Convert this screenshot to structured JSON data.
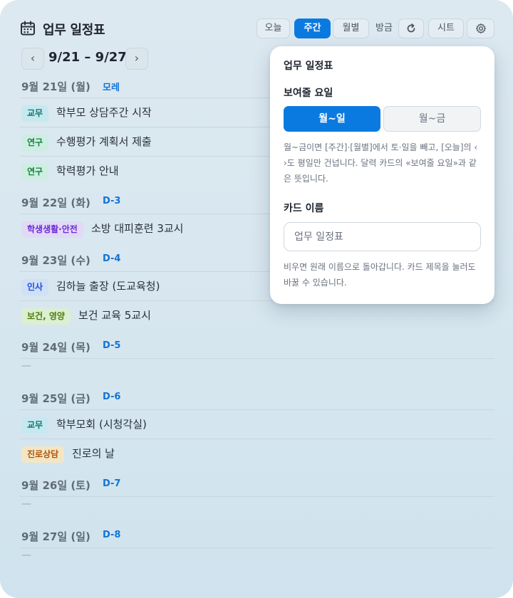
{
  "header": {
    "title": "업무 일정표",
    "calendar_icon": "calendar-icon",
    "today_label": "오늘",
    "week_label": "주간",
    "month_label": "월별",
    "just_now_label": "방금",
    "refresh_icon": "refresh-icon",
    "sheet_label": "시트",
    "settings_icon": "gear-icon",
    "active_view": "주간"
  },
  "week_nav": {
    "prev_icon": "‹",
    "next_icon": "›",
    "range": "9/21 – 9/27"
  },
  "tag_colors": {
    "교무": {
      "bg": "#c7e8ef",
      "fg": "#0f766e"
    },
    "연구": {
      "bg": "#cdeee0",
      "fg": "#15803d"
    },
    "학생생활·안전": {
      "bg": "#e1d9f6",
      "fg": "#6d28d9"
    },
    "인사": {
      "bg": "#cfe0f7",
      "fg": "#1d4ed8"
    },
    "보건, 영양": {
      "bg": "#dcefd0",
      "fg": "#4d7c0f"
    },
    "진로상담": {
      "bg": "#f3e6c4",
      "fg": "#b45309"
    }
  },
  "days": [
    {
      "date": "9월 21일 (월)",
      "dday": "모레",
      "events": [
        {
          "tag": "교무",
          "text": "학부모 상담주간 시작"
        },
        {
          "tag": "연구",
          "text": "수행평가 계획서 제출"
        },
        {
          "tag": "연구",
          "text": "학력평가 안내"
        }
      ]
    },
    {
      "date": "9월 22일 (화)",
      "dday": "D-3",
      "events": [
        {
          "tag": "학생생활·안전",
          "text": "소방 대피훈련 3교시"
        }
      ]
    },
    {
      "date": "9월 23일 (수)",
      "dday": "D-4",
      "events": [
        {
          "tag": "인사",
          "text": "김하늘 출장 (도교육청)"
        },
        {
          "tag": "보건, 영양",
          "text": "보건 교육 5교시"
        }
      ]
    },
    {
      "date": "9월 24일 (목)",
      "dday": "D-5",
      "events": [],
      "empty": "—"
    },
    {
      "date": "9월 25일 (금)",
      "dday": "D-6",
      "events": [
        {
          "tag": "교무",
          "text": "학부모회 (시청각실)"
        },
        {
          "tag": "진로상담",
          "text": "진로의 날"
        }
      ]
    },
    {
      "date": "9월 26일 (토)",
      "dday": "D-7",
      "events": [],
      "empty": "—"
    },
    {
      "date": "9월 27일 (일)",
      "dday": "D-8",
      "events": [],
      "empty": "—"
    }
  ],
  "popup": {
    "title": "업무 일정표",
    "weekday_section": "보여줄 요일",
    "option_all": "월~일",
    "option_weekdays": "월~금",
    "selected": "월~일",
    "weekday_note": "월~금이면 [주간]·[월별]에서 토·일을 빼고, [오늘]의 ‹ ›도 평일만 건넙니다. 달력 카드의 «보여줄 요일»과 같은 뜻입니다.",
    "name_section": "카드 이름",
    "name_placeholder": "업무 일정표",
    "name_value": "",
    "name_note": "비우면 원래 이름으로 돌아갑니다. 카드 제목을 눌러도 바꿀 수 있습니다."
  }
}
